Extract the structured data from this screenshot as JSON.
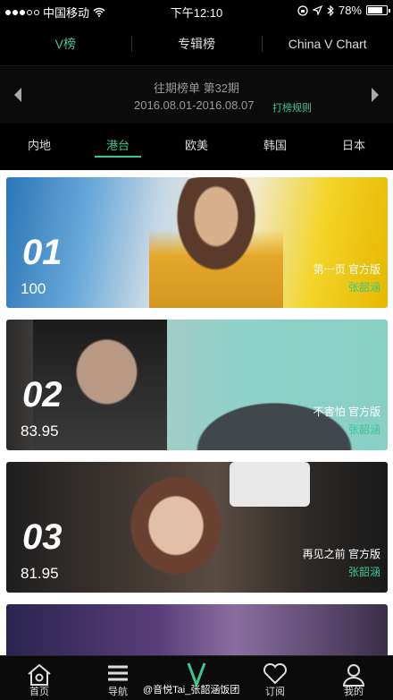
{
  "status_bar": {
    "carrier": "中国移动",
    "time": "下午12:10",
    "battery": "78%",
    "battery_level": 0.78
  },
  "top_tabs": [
    {
      "label": "V榜",
      "active": true
    },
    {
      "label": "专辑榜",
      "active": false
    },
    {
      "label": "China V Chart",
      "active": false
    }
  ],
  "period": {
    "title": "往期榜单 第32期",
    "dates": "2016.08.01-2016.08.07",
    "rules_link": "打榜规则"
  },
  "region_tabs": [
    {
      "label": "内地",
      "active": false
    },
    {
      "label": "港台",
      "active": true
    },
    {
      "label": "欧美",
      "active": false
    },
    {
      "label": "韩国",
      "active": false
    },
    {
      "label": "日本",
      "active": false
    }
  ],
  "chart_items": [
    {
      "rank": "01",
      "score": "100",
      "song": "第一页 官方版",
      "artist": "张韶涵"
    },
    {
      "rank": "02",
      "score": "83.95",
      "song": "不害怕 官方版",
      "artist": "张韶涵"
    },
    {
      "rank": "03",
      "score": "81.95",
      "song": "再见之前 官方版",
      "artist": "张韶涵"
    }
  ],
  "bottom_nav": [
    {
      "label": "首页",
      "icon": "home-icon"
    },
    {
      "label": "导航",
      "icon": "menu-icon"
    },
    {
      "label": "",
      "icon": "v-logo-icon"
    },
    {
      "label": "订阅",
      "icon": "heart-icon"
    },
    {
      "label": "我的",
      "icon": "person-icon"
    }
  ],
  "watermark": "@音悦Tai_张韶涵饭团",
  "colors": {
    "accent": "#3cc790",
    "background": "#000000"
  }
}
